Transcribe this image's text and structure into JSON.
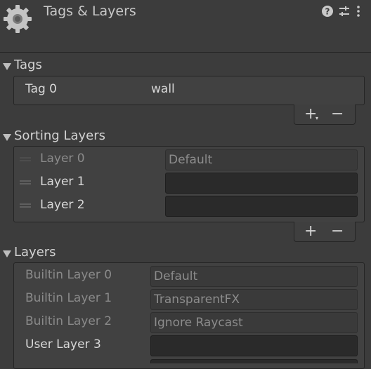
{
  "header": {
    "title": "Tags & Layers",
    "icons": [
      "gear-icon",
      "help-icon",
      "sliders-icon",
      "more-icon"
    ]
  },
  "tags": {
    "heading": "Tags",
    "items": [
      {
        "label": "Tag 0",
        "value": "wall"
      }
    ],
    "add": "+",
    "remove": "−"
  },
  "sorting_layers": {
    "heading": "Sorting Layers",
    "items": [
      {
        "label": "Layer 0",
        "value": "Default"
      },
      {
        "label": "Layer 1",
        "value": ""
      },
      {
        "label": "Layer 2",
        "value": ""
      }
    ],
    "add": "+",
    "remove": "−"
  },
  "layers": {
    "heading": "Layers",
    "items": [
      {
        "label": "Builtin Layer 0",
        "value": "Default"
      },
      {
        "label": "Builtin Layer 1",
        "value": "TransparentFX"
      },
      {
        "label": "Builtin Layer 2",
        "value": "Ignore Raycast"
      },
      {
        "label": "User Layer 3",
        "value": ""
      }
    ]
  }
}
